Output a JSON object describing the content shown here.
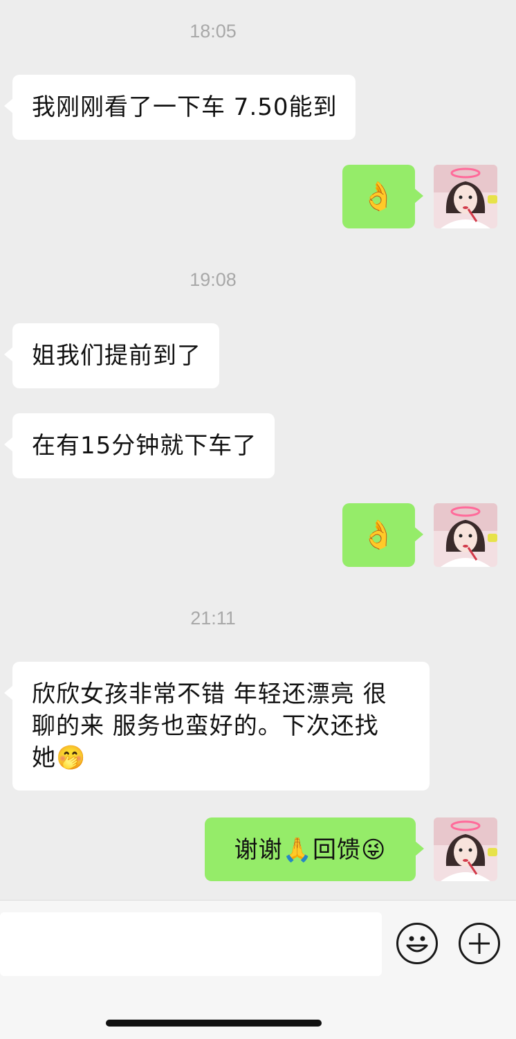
{
  "chat": {
    "messages": [
      {
        "type": "time",
        "text": "18:05"
      },
      {
        "type": "left",
        "text": "我刚刚看了一下车 7.50能到"
      },
      {
        "type": "right",
        "text": "👌",
        "avatar": "avatar-icon"
      },
      {
        "type": "time",
        "text": "19:08"
      },
      {
        "type": "left",
        "text": "姐我们提前到了"
      },
      {
        "type": "left",
        "text": "在有15分钟就下车了"
      },
      {
        "type": "right",
        "text": "👌",
        "avatar": "avatar-icon"
      },
      {
        "type": "time",
        "text": "21:11"
      },
      {
        "type": "left",
        "lines": [
          "欣欣女孩非常不错 年轻还漂亮 很",
          "聊的来 服务也蛮好的。下次还找",
          "她🤭"
        ]
      },
      {
        "type": "right",
        "text": "谢谢🙏回馈😜",
        "avatar": "avatar-icon"
      }
    ]
  },
  "input_bar": {
    "placeholder": "",
    "emoji_button_icon": "smiley-icon",
    "more_button_icon": "plus-icon"
  },
  "colors": {
    "background": "#ededed",
    "incoming_bubble": "#ffffff",
    "outgoing_bubble": "#95ec69",
    "timestamp": "#a8a8a8"
  }
}
